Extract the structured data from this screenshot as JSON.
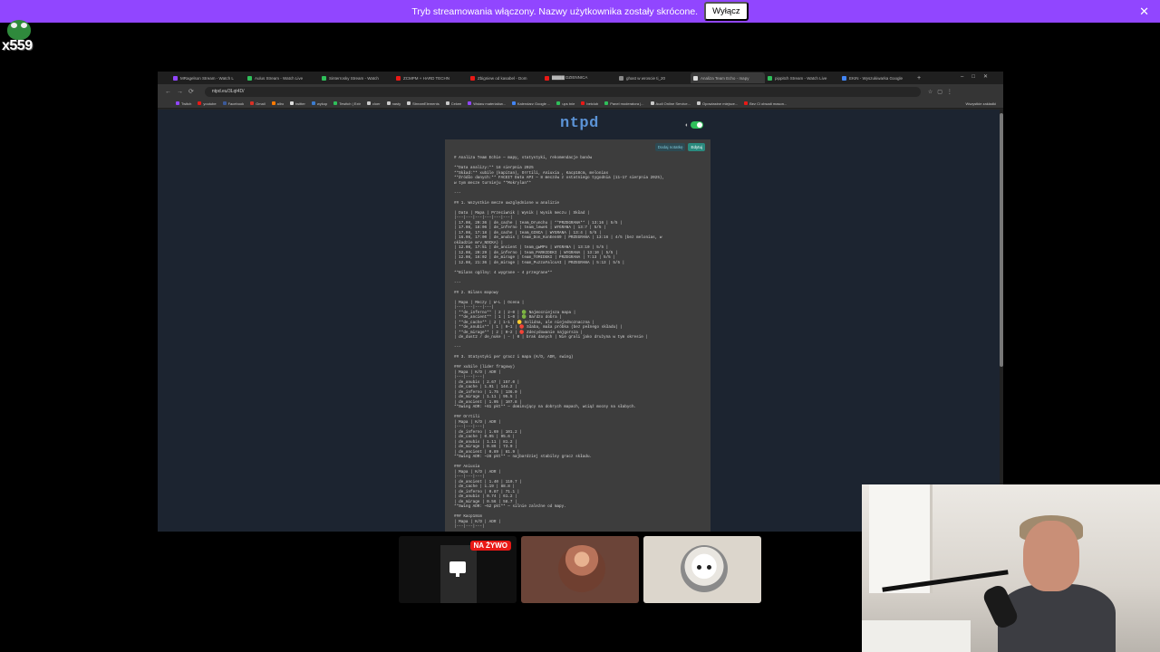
{
  "banner": {
    "message": "Tryb streamowania włączony. Nazwy użytkownika zostały skrócone.",
    "button": "Wyłącz",
    "close": "✕"
  },
  "channel": {
    "logo_text": "x559"
  },
  "browser": {
    "tabs": [
      {
        "label": "MRagelson Stream - Watch L",
        "color": "#9146ff",
        "active": false
      },
      {
        "label": "Aulus Stream - Watch Live",
        "color": "#2fbf5a",
        "active": false
      },
      {
        "label": "Sinterrosky Stream - Watch",
        "color": "#2fbf5a",
        "active": false
      },
      {
        "label": "ZCMPM + HARD TECHN",
        "color": "#e91916",
        "active": false
      },
      {
        "label": "Zbigniew od kasabel - Dom",
        "color": "#e91916",
        "active": false
      },
      {
        "label": "▇▇▇▇ DZIENNICA",
        "color": "#e91916",
        "active": false
      },
      {
        "label": "ghast w wroscie ti_20",
        "color": "#888888",
        "active": false
      },
      {
        "label": "Analiza Team Echo - mapy",
        "color": "#dddddd",
        "active": true
      },
      {
        "label": "pippitch Stream - Watch Live",
        "color": "#2fbf5a",
        "active": false
      },
      {
        "label": "EKIN - Wyszukiwarka Google",
        "color": "#4285f4",
        "active": false
      }
    ],
    "url": "ntpd.eu/3Lqt4D/",
    "bookmarks": [
      {
        "label": "Twitch",
        "color": "#9146ff"
      },
      {
        "label": "youtube",
        "color": "#e91916"
      },
      {
        "label": "Facebook",
        "color": "#3b5998"
      },
      {
        "label": "Gmail",
        "color": "#d93025"
      },
      {
        "label": "allro",
        "color": "#ff7a00"
      },
      {
        "label": "twitter",
        "color": "#dddddd"
      },
      {
        "label": "wykop",
        "color": "#3b7ccf"
      },
      {
        "label": "Tewitch | Extr",
        "color": "#2fbf5a"
      },
      {
        "label": "cloer",
        "color": "#c8c8c8"
      },
      {
        "label": "nasty",
        "color": "#c8c8c8"
      },
      {
        "label": "StreamElements",
        "color": "#cccccc"
      },
      {
        "label": "Cekee",
        "color": "#c8c8c8"
      },
      {
        "label": "Wstaw materiałów...",
        "color": "#9146ff"
      },
      {
        "label": "Kalendarz Google ...",
        "color": "#4285f4"
      },
      {
        "label": "ups tnie",
        "color": "#2fbf5a"
      },
      {
        "label": "betclub",
        "color": "#e91916"
      },
      {
        "label": "Panel moderatora |...",
        "color": "#2fbf5a"
      },
      {
        "label": "Audi Online Service...",
        "color": "#c8c8c8"
      },
      {
        "label": "Opowiastne miejsce...",
        "color": "#c8c8c8"
      },
      {
        "label": "Bez Ci obsadi mason...",
        "color": "#e91916"
      }
    ],
    "bookmarks_right": "Wszystkie zakładki"
  },
  "page": {
    "site_title": "ntpd",
    "note": {
      "add_button": "Dodaj notatkę",
      "edit_button": "Edytuj",
      "body": "# Analiza Team Echie — mapy, statystyki, rekomendacje banów\n\n**Data analizy:** 18 sierpnia 2025\n**Skład:** xubile (kapitan), Orrtili, Aniuxia , Kacp18cm, melonias\n**Źródło danych:** FACEIT Data API — 8 meczów z ostatniego tygodnia (11–17 sierpnia 2025),\nw tym mecze turnieju **Mokrylan**\n\n---\n\n## 1. Wszystkie mecze uwzględnione w analizie\n\n| Data | Mapa | Przeciwnik | Wynik | Wynik meczu | Skład |\n|---|---|---|---|---|---|\n| 17.08, 20:36 | de_cache | team_Drunchu | **PRZEGRANA** | 13:16 | 5/5 |\n| 17.08, 18:06 | de_inferno | team_lewek | WYGRANA | 13:7 | 5/5 |\n| 17.08, 17:18 | de_cache | team_GINCA | WYGRANA | 13:4 | 5/5 |\n| 16.08, 17:00 | de_anubis | team_Don_KonEen69 | PRZEGRANA | 13:16 | 4/5 (bez melonias, w\nokładzie mrv_NOCKA) |\n| 12.08, 17:51 | de_ancient | team_gwMPo | WYGRANA | 13:10 | 5/5 |\n| 12.08, 20:29 | de_inferno | team_PARKIDEKI | WYGRANA | 13:10 | 5/5 |\n| 12.08, 16:02 | de_mirage | team_TOMIDEKI | PRZEGRANA | 7:13 | 5/5 |\n| 12.08, 21:36 | de_mirage | team_PuzzaFalcoAI | PRZEGRANA | 5:13 | 5/5 |\n\n**Bilans ogólny: 4 wygrane – 4 przegrane**\n\n---\n\n## 2. Bilans mapowy\n\n| Mapa | Meczy | W–L | Ocena |\n|---|---|---|---|\n| **de_inferno** | 2 | 2–0 | 🟢 Najmocniejsza mapa |\n| **de_ancient** | 1 | 1–0 | 🟢 Bardzo dobra |\n| **de_cache** | 2 | 1–1 | 🟡 Solidna, ale niejednoznaczna |\n| **de_anubis** | 1 | 0–1 | 🔴 Słaba, mała próbka (bez pełnego składu) |\n| **de_mirage** | 2 | 0–2 | 🔴 Zdecydowanie najgorsza |\n| de_dust2 / de_nuke | – | 0 | brak danych | Nie grali jako drużyna w tym okresie |\n\n---\n\n## 3. Statystyki per gracz i mapa (K/D, ADR, swing)\n\n### xubile (lider fragowy)\n| Mapa | K/D | ADR |\n|---|---|---|\n| de_anubis | 2.67 | 157.0 |\n| de_cache | 1.91 | 144.2 |\n| de_inferno | 1.75 | 136.0 |\n| de_mirage | 1.11 | 95.5 |\n| de_ancient | 1.05 | 107.8 |\n**Swing ADR: +61 pkt** — dominujący na dobrych mapach, wciąż mocny na słabych.\n\n### Orrtili\n| Mapa | K/D | ADR |\n|---|---|---|\n| de_inferno | 1.69 | 101.2 |\n| de_cache | 0.95 | 95.6 |\n| de_anubis | 1.11 | 81.2 |\n| de_mirage | 0.86 | 73.0 |\n| de_ancient | 0.89 | 81.9 |\n**Swing ADR: ~28 pkt** — najbardziej stabilny gracz składu.\n\n### Aniuxia\n| Mapa | K/D | ADR |\n|---|---|---|\n| de_ancient | 1.40 | 110.7 |\n| de_cache | 1.19 | 88.8 |\n| de_inferno | 0.87 | 71.1 |\n| de_anubis | 0.74 | 61.2 |\n| de_mirage | 0.56 | 58.7 |\n**Swing ADR: ~52 pkt** — silnie zależne od mapy.\n\n### Kacp18cm\n| Mapa | K/D | ADR |\n|---|---|---|"
    }
  },
  "participants": {
    "live_badge": "NA ŻYWO"
  }
}
